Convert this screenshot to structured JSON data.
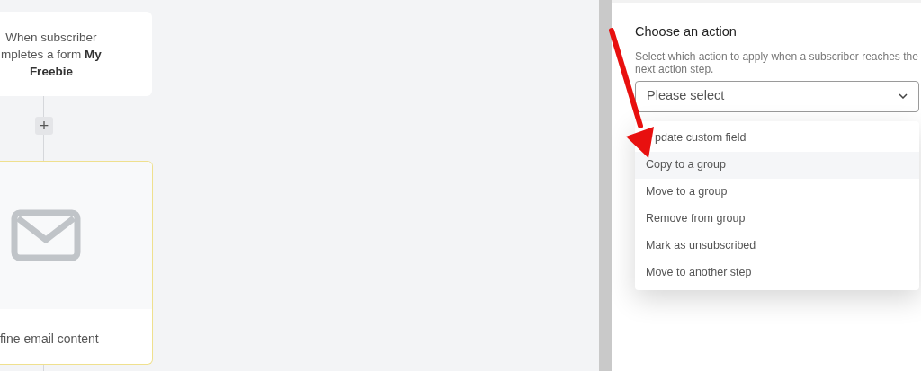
{
  "canvas": {
    "trigger_card": {
      "lines": [
        "When subscriber",
        "mpletes a form **My**",
        "**Freebie**"
      ]
    },
    "add_step": {
      "label": "+"
    },
    "email_card": {
      "caption": "fine email content",
      "highlighted": true
    }
  },
  "panel": {
    "title": "Choose an action",
    "description": "Select which action to apply when a subscriber reaches the next action step.",
    "select": {
      "placeholder": "Please select",
      "expanded": true
    },
    "options": [
      {
        "label": "pdate custom field",
        "selected": false
      },
      {
        "label": "Copy to a group",
        "selected": true
      },
      {
        "label": "Move to a group",
        "selected": false
      },
      {
        "label": "Remove from group",
        "selected": false
      },
      {
        "label": "Mark as unsubscribed",
        "selected": false
      },
      {
        "label": "Move to another step",
        "selected": false
      }
    ]
  }
}
